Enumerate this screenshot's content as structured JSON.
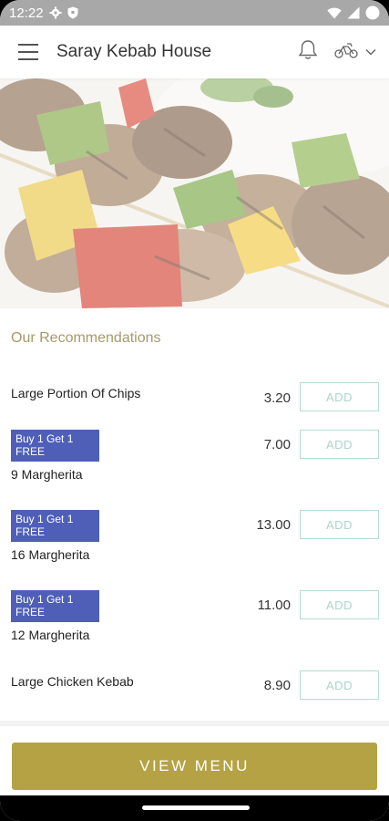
{
  "status_bar": {
    "time": "12:22",
    "icons": [
      "gear-icon",
      "shield-icon",
      "wifi-icon",
      "signal-icon",
      "battery-icon"
    ]
  },
  "app_bar": {
    "title": "Saray Kebab House",
    "icons": [
      "menu-icon",
      "bell-icon",
      "delivery-icon",
      "chevron-down-icon"
    ]
  },
  "hero": {
    "description_icon": "kebab-skewer-photo"
  },
  "recommendations": {
    "title": "Our Recommendations",
    "add_label": "ADD",
    "items": [
      {
        "name": "Large Portion Of Chips",
        "price": "3.20",
        "badge": ""
      },
      {
        "name": "9 Margherita",
        "price": "7.00",
        "badge": "Buy 1 Get 1 FREE"
      },
      {
        "name": "16 Margherita",
        "price": "13.00",
        "badge": "Buy 1 Get 1 FREE"
      },
      {
        "name": "12 Margherita",
        "price": "11.00",
        "badge": "Buy 1 Get 1 FREE"
      },
      {
        "name": "Large Chicken Kebab",
        "price": "8.90",
        "badge": ""
      }
    ]
  },
  "footer": {
    "view_menu_label": "VIEW MENU"
  },
  "colors": {
    "accent_gold": "#b5a244",
    "section_title": "#a8996a",
    "badge_blue": "#4f5fb8",
    "add_border": "#b6ddd0",
    "add_text": "#a9d7c7"
  }
}
